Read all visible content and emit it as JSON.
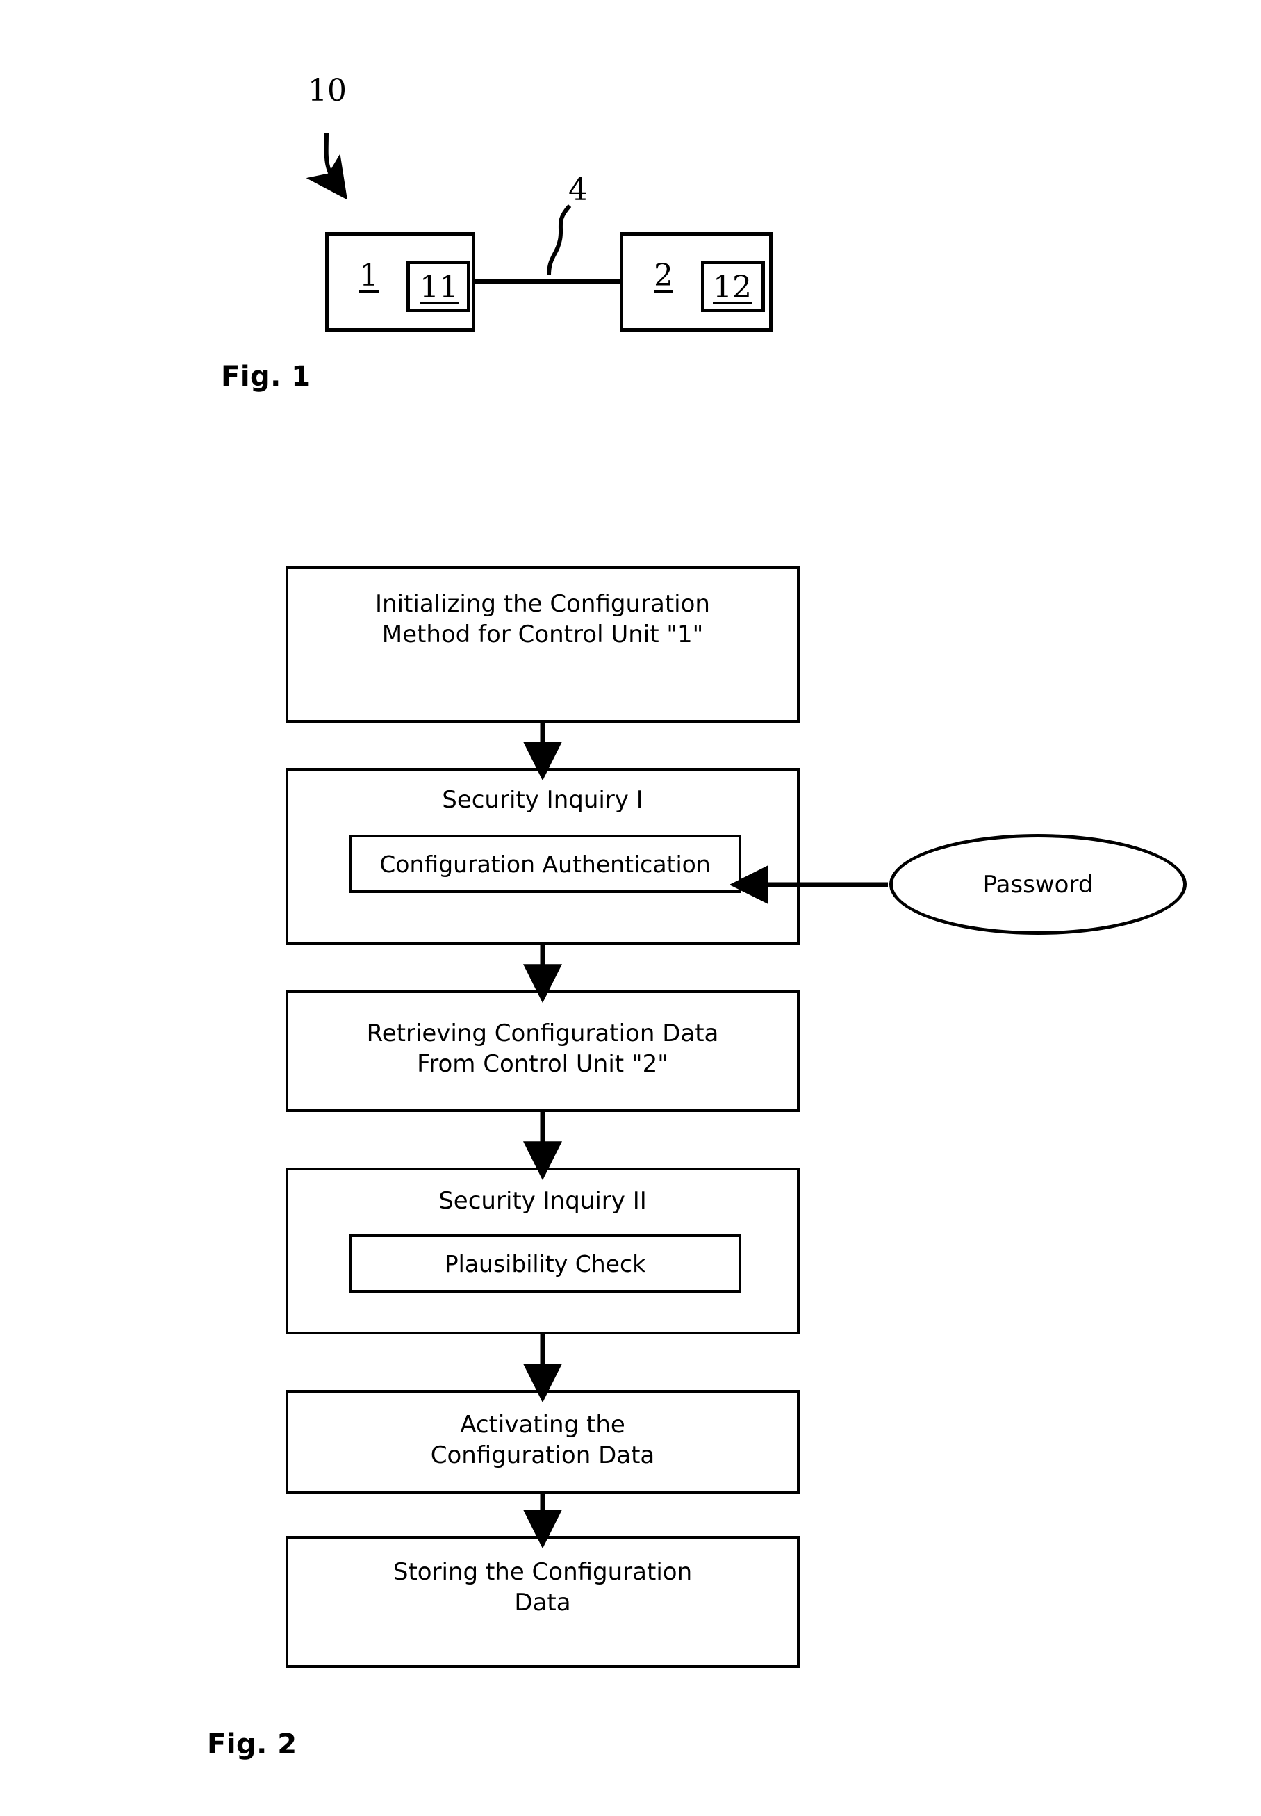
{
  "page": {
    "background": "#ffffff",
    "ink": "#000000"
  },
  "figure1": {
    "caption": "Fig. 1",
    "system_numeral": "10",
    "link_numeral": "4",
    "units": [
      {
        "numeral": "1",
        "inner_numeral": "11"
      },
      {
        "numeral": "2",
        "inner_numeral": "12"
      }
    ]
  },
  "figure2": {
    "caption": "Fig. 2",
    "steps": [
      {
        "title": "Initializing the Configuration\nMethod for Control Unit \"1\"",
        "sub": null
      },
      {
        "title": "Security Inquiry I",
        "sub": "Configuration Authentication"
      },
      {
        "title": "Retrieving Configuration Data\nFrom Control Unit \"2\"",
        "sub": null
      },
      {
        "title": "Security Inquiry II",
        "sub": "Plausibility Check"
      },
      {
        "title": "Activating the\nConfiguration Data",
        "sub": null
      },
      {
        "title": "Storing the Configuration\nData",
        "sub": null
      }
    ],
    "input_node": {
      "label": "Password"
    }
  }
}
